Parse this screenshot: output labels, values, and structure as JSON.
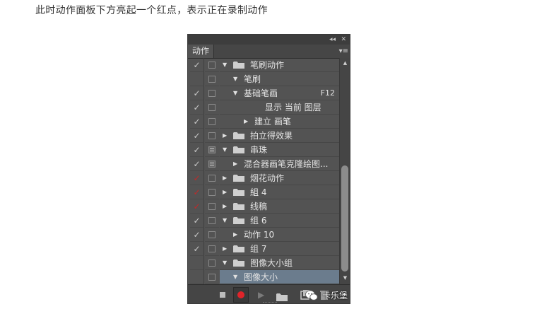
{
  "caption": "此时动作面板下方亮起一个红点，表示正在录制动作",
  "panel": {
    "tab_label": "动作",
    "collapse_glyph": "◂◂",
    "close_glyph": "✕",
    "menu_glyph": "▾≡"
  },
  "rows": [
    {
      "label": "笔刷动作",
      "shortcut": "",
      "check": "✓",
      "check_red": false,
      "dialog": false,
      "indent": 0,
      "tri": "▼",
      "folder": true,
      "selected": false
    },
    {
      "label": "笔刷",
      "shortcut": "",
      "check": "",
      "check_red": false,
      "dialog": false,
      "indent": 1,
      "tri": "▼",
      "folder": false,
      "selected": false
    },
    {
      "label": "基础笔画",
      "shortcut": "F12",
      "check": "✓",
      "check_red": false,
      "dialog": false,
      "indent": 1,
      "tri": "▼",
      "folder": false,
      "selected": false
    },
    {
      "label": "显示 当前 图层",
      "shortcut": "",
      "check": "✓",
      "check_red": false,
      "dialog": false,
      "indent": 3,
      "tri": "",
      "folder": false,
      "selected": false
    },
    {
      "label": "建立 画笔",
      "shortcut": "",
      "check": "✓",
      "check_red": false,
      "dialog": false,
      "indent": 2,
      "tri": "▶",
      "folder": false,
      "selected": false
    },
    {
      "label": "拍立得效果",
      "shortcut": "",
      "check": "✓",
      "check_red": false,
      "dialog": false,
      "indent": 0,
      "tri": "▶",
      "folder": true,
      "selected": false
    },
    {
      "label": "串珠",
      "shortcut": "",
      "check": "✓",
      "check_red": false,
      "dialog": true,
      "indent": 0,
      "tri": "▼",
      "folder": true,
      "selected": false
    },
    {
      "label": "混合器画笔克隆绘图...",
      "shortcut": "",
      "check": "✓",
      "check_red": false,
      "dialog": true,
      "indent": 1,
      "tri": "▶",
      "folder": false,
      "selected": false
    },
    {
      "label": "烟花动作",
      "shortcut": "",
      "check": "✓",
      "check_red": true,
      "dialog": false,
      "indent": 0,
      "tri": "▶",
      "folder": true,
      "selected": false
    },
    {
      "label": "組 4",
      "shortcut": "",
      "check": "✓",
      "check_red": true,
      "dialog": false,
      "indent": 0,
      "tri": "▶",
      "folder": true,
      "selected": false
    },
    {
      "label": "线稿",
      "shortcut": "",
      "check": "✓",
      "check_red": true,
      "dialog": false,
      "indent": 0,
      "tri": "▶",
      "folder": true,
      "selected": false
    },
    {
      "label": "组 6",
      "shortcut": "",
      "check": "✓",
      "check_red": false,
      "dialog": false,
      "indent": 0,
      "tri": "▼",
      "folder": true,
      "selected": false
    },
    {
      "label": "动作 10",
      "shortcut": "",
      "check": "✓",
      "check_red": false,
      "dialog": false,
      "indent": 1,
      "tri": "▶",
      "folder": false,
      "selected": false
    },
    {
      "label": "组 7",
      "shortcut": "",
      "check": "✓",
      "check_red": false,
      "dialog": false,
      "indent": 0,
      "tri": "▶",
      "folder": true,
      "selected": false
    },
    {
      "label": "图像大小组",
      "shortcut": "",
      "check": "",
      "check_red": false,
      "dialog": false,
      "indent": 0,
      "tri": "▼",
      "folder": true,
      "selected": false
    },
    {
      "label": "图像大小",
      "shortcut": "",
      "check": "",
      "check_red": false,
      "dialog": false,
      "indent": 1,
      "tri": "▼",
      "folder": false,
      "selected": true
    }
  ],
  "scrollbar": {
    "up": "▲",
    "down": "▼"
  },
  "bottom": {
    "play_glyph": "▶"
  },
  "watermark": {
    "text": "卡乐堡"
  },
  "colors": {
    "record_red": "#e0242a",
    "panel_bg": "#535353",
    "selection": "#6b7c8d"
  }
}
